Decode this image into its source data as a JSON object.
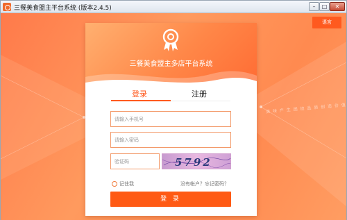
{
  "window": {
    "title": "三餐美食盟主平台系统 (版本2.4.5)",
    "controls": {
      "minimize": "–",
      "maximize": "□",
      "close": "✕"
    }
  },
  "language_button": "语言",
  "watermark": "美 味 产 生 团 结 品 质 创 造 价 值",
  "card": {
    "title": "三餐美食盟主多店平台系统",
    "icon": "award-badge-icon"
  },
  "tabs": [
    {
      "label": "登录",
      "active": true
    },
    {
      "label": "注册",
      "active": false
    }
  ],
  "form": {
    "phone_placeholder": "请输入手机号",
    "password_placeholder": "请输入密码",
    "code_placeholder": "验证码",
    "captcha_text": "5792",
    "remember_label": "记住我",
    "no_account_link": "没有帐户？",
    "forgot_link": "忘记密码？",
    "login_button": "登 录"
  },
  "colors": {
    "accent": "#ff5a1f",
    "background": "#ff8a55"
  }
}
